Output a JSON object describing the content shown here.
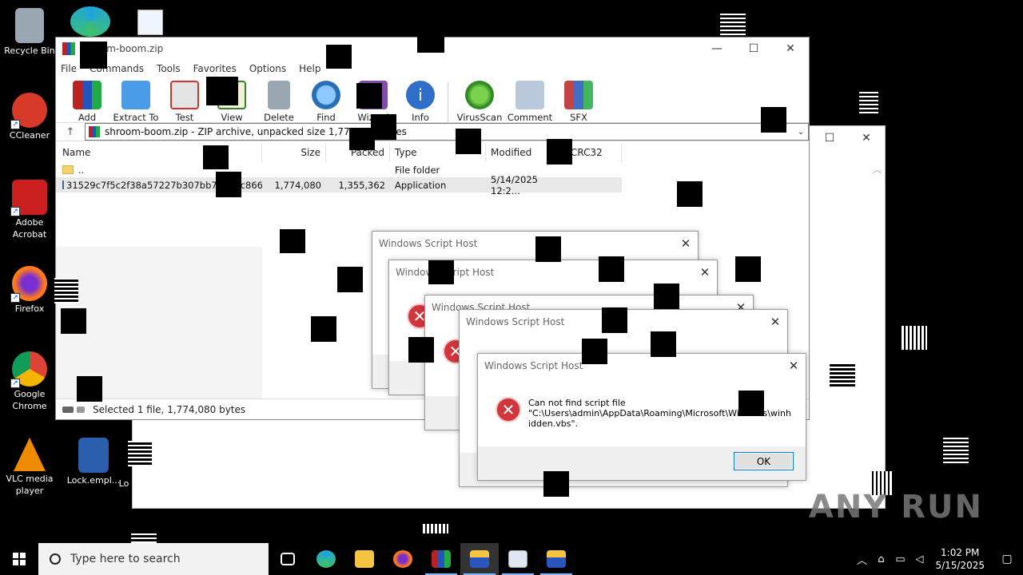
{
  "desktop": {
    "icons": [
      {
        "label": "Recycle Bin",
        "color": "#9aa7b3"
      },
      {
        "label": "CCleaner",
        "color": "#d83a2a"
      },
      {
        "label": "Adobe Acrobat",
        "color": "#cc1f1f"
      },
      {
        "label": "Firefox",
        "color": "#ff7a1a"
      },
      {
        "label": "Google Chrome",
        "color": "#2f9e44"
      },
      {
        "label": "VLC media player",
        "color": "#f08a00"
      },
      {
        "label": "Lock.empl...",
        "color": "#2b5fad"
      },
      {
        "label": "Lo",
        "color": "#ffffff"
      }
    ]
  },
  "winrar": {
    "title": "shroom-boom.zip",
    "menu": [
      "File",
      "Commands",
      "Tools",
      "Favorites",
      "Options",
      "Help"
    ],
    "toolbar": [
      "Add",
      "Extract To",
      "Test",
      "View",
      "Delete",
      "Find",
      "Wizard",
      "Info",
      "VirusScan",
      "Comment",
      "SFX"
    ],
    "path": "shroom-boom.zip - ZIP archive, unpacked size 1,774,080 bytes",
    "columns": {
      "name": "Name",
      "size": "Size",
      "packed": "Packed",
      "type": "Type",
      "modified": "Modified",
      "crc": "CRC32"
    },
    "rows": [
      {
        "name": "..",
        "size": "",
        "packed": "",
        "type": "File folder",
        "modified": ""
      },
      {
        "name": "31529c7f5c2f38a57227b307bb77e2dc86628...",
        "size": "1,774,080",
        "packed": "1,355,362",
        "type": "Application",
        "modified": "5/14/2025 12:2..."
      }
    ],
    "status": "Selected 1 file, 1,774,080 bytes"
  },
  "dialogs": {
    "title": "Windows Script Host",
    "message_line1": "Can not find script file",
    "message_line2": "\"C:\\Users\\admin\\AppData\\Roaming\\Microsoft\\Windows\\winh",
    "message_line3": "idden.vbs\".",
    "ok": "OK"
  },
  "watermark": "ANY RUN",
  "taskbar": {
    "search_placeholder": "Type here to search",
    "time": "1:02 PM",
    "date": "5/15/2025"
  }
}
